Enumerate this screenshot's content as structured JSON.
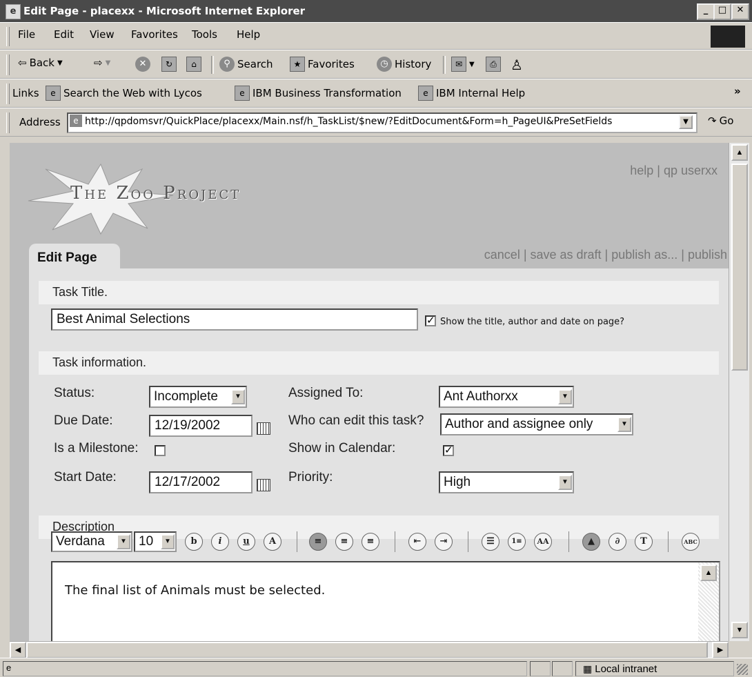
{
  "window": {
    "title": "Edit Page - placexx - Microsoft Internet Explorer"
  },
  "menu": [
    "File",
    "Edit",
    "View",
    "Favorites",
    "Tools",
    "Help"
  ],
  "toolbar": {
    "back": "Back",
    "search": "Search",
    "favorites": "Favorites",
    "history": "History"
  },
  "links": {
    "label": "Links",
    "items": [
      "Search the Web with Lycos",
      "IBM Business Transformation",
      "IBM Internal Help"
    ],
    "more": "»"
  },
  "address": {
    "label": "Address",
    "url": "http://qpdomsvr/QuickPlace/placexx/Main.nsf/h_TaskList/$new/?EditDocument&Form=h_PageUI&PreSetFields",
    "go": "Go"
  },
  "page": {
    "logo_text": "The Zoo Project",
    "top_links": "help | qp userxx",
    "tab": "Edit Page",
    "actions": "cancel | save as draft | publish as... | publish",
    "task_title_section": "Task Title.",
    "task_title_value": "Best Animal Selections",
    "show_title_label": "Show the title, author and date on page?",
    "task_info_section": "Task information.",
    "status_label": "Status:",
    "status_value": "Incomplete",
    "due_label": "Due Date:",
    "due_value": "12/19/2002",
    "milestone_label": "Is a Milestone:",
    "start_label": "Start Date:",
    "start_value": "12/17/2002",
    "assigned_label": "Assigned To:",
    "assigned_value": "Ant Authorxx",
    "who_edit_label": "Who can edit this task?",
    "who_edit_value": "Author and assignee only",
    "show_cal_label": "Show in Calendar:",
    "priority_label": "Priority:",
    "priority_value": "High",
    "description_section": "Description",
    "font_value": "Verdana",
    "size_value": "10",
    "description_text": "The final list of Animals must be selected."
  },
  "status_bar": {
    "zone": "Local intranet"
  }
}
